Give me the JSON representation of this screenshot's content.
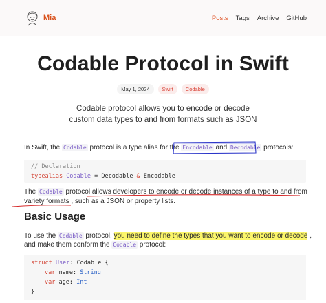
{
  "header": {
    "brand": "Mia",
    "nav": [
      "Posts",
      "Tags",
      "Archive",
      "GitHub"
    ]
  },
  "post": {
    "title": "Codable Protocol in Swift",
    "date": "May 1, 2024",
    "tags": [
      "Swift",
      "Codable"
    ],
    "lead_line1": "Codable protocol allows you to encode or decode",
    "lead_line2": "custom data types to and from formats such as JSON",
    "p1": {
      "before": "In Swift, the ",
      "code1": "Codable",
      "mid": " protocol is a type alias for the ",
      "code2": "Encodable",
      "and": " and ",
      "code3": "Decodable",
      "after": " protocols:"
    },
    "code1": {
      "comment": "// Declaration",
      "kw": "typealias",
      "name": "Codable",
      "eq": " = ",
      "a": "Decodable",
      "amp": " & ",
      "b": "Encodable"
    },
    "p2": {
      "before": "The ",
      "code": "Codable",
      "line1_rest": " protocol allows developers to encode or decode instances of a type to and from",
      "line2_a": "variety formats",
      "line2_b": " , such as a JSON or property lists."
    },
    "h2": "Basic Usage",
    "p3": {
      "before": "To use the ",
      "code": "Codable",
      "mid": " protocol, ",
      "highlight": "you need to define the types that you want to encode or decode",
      "after": " ,",
      "line2_a": "and make them conform the ",
      "line2_code": "Codable",
      "line2_b": " protocol:"
    },
    "code2": {
      "l1_kw": "struct",
      "l1_name": "User",
      "l1_rest": ": Codable {",
      "l2_kw": "var",
      "l2_name": " name: ",
      "l2_type": "String",
      "l3_kw": "var",
      "l3_name": " age: ",
      "l3_type": "Int",
      "l4": "}"
    }
  },
  "colors": {
    "accent": "#e0572a",
    "annotation_red": "#d62a2a",
    "annotation_blue": "#2b35c9",
    "highlight": "#fbf56a"
  }
}
